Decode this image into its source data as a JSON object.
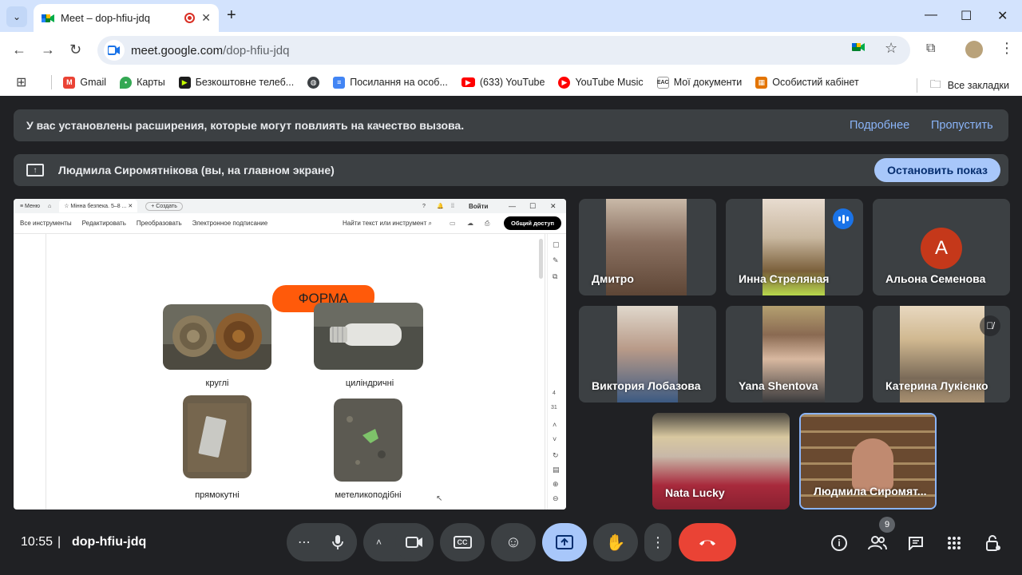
{
  "browser": {
    "tab_title": "Meet – dop-hfiu-jdq",
    "new_tab": "+",
    "url_host": "meet.google.com",
    "url_path": "/dop-hfiu-jdq",
    "bookmarks": [
      {
        "label": "Gmail",
        "icon": "gmail-icon",
        "color": "#ea4335"
      },
      {
        "label": "Карты",
        "icon": "maps-icon",
        "color": "#34a853"
      },
      {
        "label": "Безкоштовне телеб...",
        "icon": "tv-icon",
        "color": "#1c1c1c"
      },
      {
        "label": "",
        "icon": "globe-icon",
        "color": "#3c4043"
      },
      {
        "label": "Посилання на особ...",
        "icon": "docs-icon",
        "color": "#4285f4"
      },
      {
        "label": "(633) YouTube",
        "icon": "youtube-icon",
        "color": "#ff0000"
      },
      {
        "label": "YouTube Music",
        "icon": "youtube-music-icon",
        "color": "#ff0000"
      },
      {
        "label": "Мої документи",
        "icon": "eas-icon",
        "color": "#5f6368"
      },
      {
        "label": "Особистий кабінет",
        "icon": "cabinet-icon",
        "color": "#e37400"
      }
    ],
    "all_bookmarks": "Все закладки"
  },
  "meet": {
    "extensions_banner": {
      "text": "У вас установлены расширения, которые могут повлиять на качество вызова.",
      "more": "Подробнее",
      "skip": "Пропустить"
    },
    "presenting_banner": {
      "text": "Людмила Сиромятнікова (вы, на главном экране)",
      "stop": "Остановить показ"
    },
    "shared_screen": {
      "menu": "Меню",
      "doc_tab": "Мінна безпека. 5–8 ...",
      "create": "+ Создать",
      "login": "Войти",
      "toolbar": [
        "Все инструменты",
        "Редактировать",
        "Преобразовать",
        "Электронное подписание"
      ],
      "find": "Найти текст или инструмент",
      "share": "Общий доступ",
      "slide_title": "ФОРМА",
      "captions": [
        "круглі",
        "циліндричні",
        "прямокутні",
        "метеликоподібні"
      ],
      "page_current": "4",
      "page_total": "31"
    },
    "participants": [
      {
        "name": "Дмитро"
      },
      {
        "name": "Инна Стреляная",
        "speaking": true
      },
      {
        "name": "Альона Семенова",
        "initial": "А",
        "avatar_color": "#c5381a"
      },
      {
        "name": "Виктория Лобазова"
      },
      {
        "name": "Yana Shentova"
      },
      {
        "name": "Катерина Лукієнко",
        "muted": true
      },
      {
        "name": "Nata Lucky"
      },
      {
        "name": "Людмила Сиромят..."
      }
    ],
    "time": "10:55",
    "meeting_code": "dop-hfiu-jdq",
    "people_count": "9",
    "end_call_color": "#ea4335",
    "present_active_color": "#a8c7fa"
  }
}
